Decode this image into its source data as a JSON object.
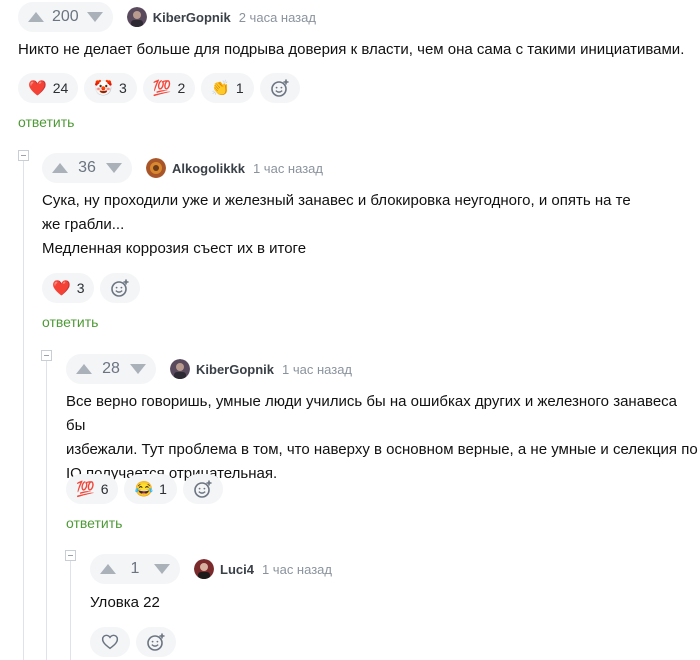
{
  "comments": [
    {
      "score": "200",
      "author": "KiberGopnik",
      "time": "2 часа назад",
      "lines": [
        "Никто не делает больше для подрыва доверия к власти, чем она сама с такими инициативами."
      ],
      "reactions": [
        {
          "emoji": "❤️",
          "icon": "heart-icon",
          "count": "24"
        },
        {
          "emoji": "🤡",
          "icon": "clown-face-icon",
          "count": "3"
        },
        {
          "emoji": "💯",
          "icon": "hundred-points-icon",
          "count": "2"
        },
        {
          "emoji": "👏",
          "icon": "clapping-hands-icon",
          "count": "1"
        }
      ],
      "reply": "ответить"
    },
    {
      "score": "36",
      "author": "Alkogolikkk",
      "time": "1 час назад",
      "lines": [
        "Сука, ну проходили уже и железный занавес и блокировка неугодного, и опять на те",
        "же грабли...",
        "Медленная коррозия съест их в итоге"
      ],
      "reactions": [
        {
          "emoji": "❤️",
          "icon": "heart-icon",
          "count": "3"
        }
      ],
      "reply": "ответить"
    },
    {
      "score": "28",
      "author": "KiberGopnik",
      "time": "1 час назад",
      "lines": [
        "Все верно говоришь, умные люди учились бы на ошибках других и железного занавеса бы",
        "избежали. Тут проблема в том, что наверху в основном верные, а не умные и селекция по",
        "IQ получается отрицательная."
      ],
      "reactions": [
        {
          "emoji": "💯",
          "icon": "hundred-points-icon",
          "count": "6"
        },
        {
          "emoji": "😂",
          "icon": "laughing-face-icon",
          "count": "1"
        }
      ],
      "reply": "ответить"
    },
    {
      "score": "1",
      "author": "Luci4",
      "time": "1 час назад",
      "lines": [
        "Уловка 22"
      ],
      "reactions": [],
      "reply": ""
    }
  ],
  "colors": {
    "reply_link": "#4d9a35",
    "pill_bg": "#f3f5f7",
    "arrow": "#aab1b9"
  }
}
